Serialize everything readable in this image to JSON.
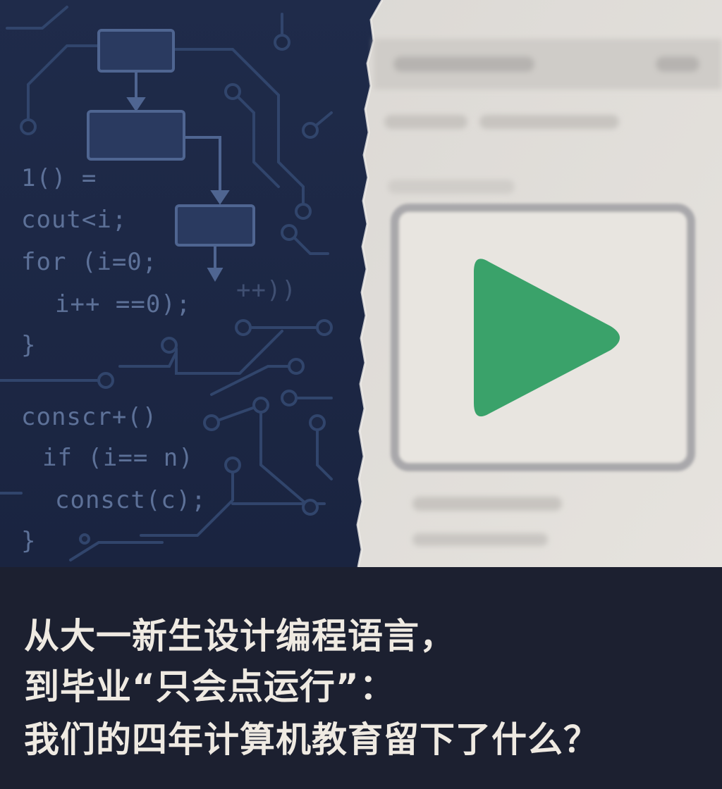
{
  "code": {
    "lines": [
      "1() =",
      "cout<i;",
      "for (i=0;",
      "i++ ==0);",
      "}",
      "conscr+()",
      "if (i== n)",
      "consct(c);",
      "}"
    ],
    "stray": "++))"
  },
  "icons": {
    "play": "play-icon"
  },
  "colors": {
    "background": "#1c2030",
    "code_panel": "#1f2c4a",
    "code_text": "#5d7198",
    "screen_panel": "#e4e1dc",
    "play_button": "#3aa26a",
    "caption_text": "#efeae2"
  },
  "caption": {
    "line1": "从大一新生设计编程语言，",
    "line2": "到毕业“只会点运行”：",
    "line3": "我们的四年计算机教育留下了什么？"
  }
}
